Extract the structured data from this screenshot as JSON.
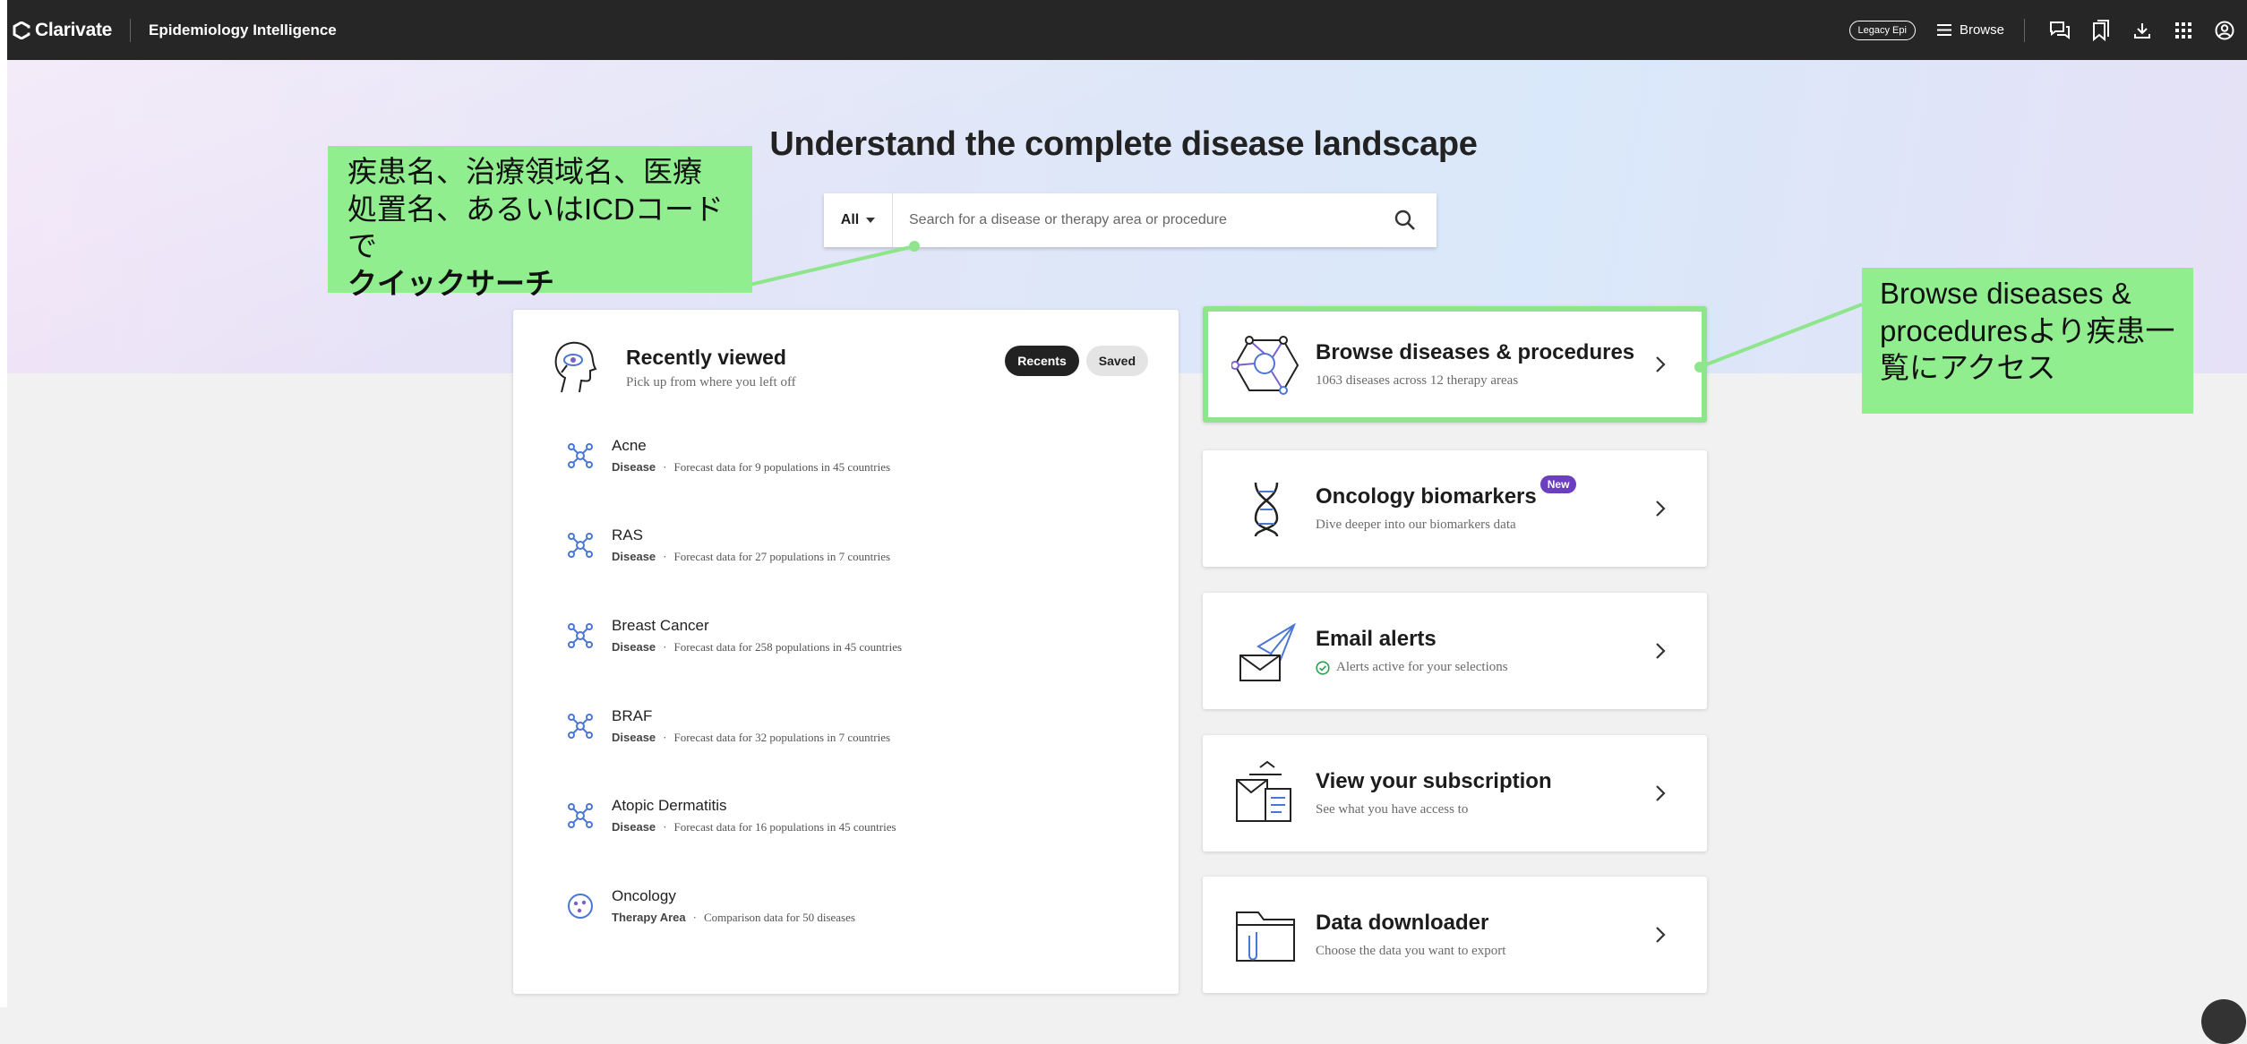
{
  "header": {
    "brand": "Clarivate",
    "product": "Epidemiology Intelligence",
    "legacy_label": "Legacy Epi",
    "browse_label": "Browse",
    "icons": [
      "chat-icon",
      "bookmark-icon",
      "download-icon",
      "apps-grid-icon",
      "user-account-icon"
    ]
  },
  "hero": {
    "headline": "Understand the complete disease landscape",
    "search": {
      "scope": "All",
      "placeholder": "Search for a disease or therapy area or procedure"
    }
  },
  "recent": {
    "title": "Recently viewed",
    "subtitle": "Pick up from where you left off",
    "tabs": {
      "recents": "Recents",
      "saved": "Saved"
    },
    "items": [
      {
        "name": "Acne",
        "kind": "Disease",
        "detail": "Forecast data for 9 populations in 45 countries",
        "icon": "molecule-icon"
      },
      {
        "name": "RAS",
        "kind": "Disease",
        "detail": "Forecast data for 27 populations in 7 countries",
        "icon": "molecule-icon"
      },
      {
        "name": "Breast Cancer",
        "kind": "Disease",
        "detail": "Forecast data for 258 populations in 45 countries",
        "icon": "molecule-icon"
      },
      {
        "name": "BRAF",
        "kind": "Disease",
        "detail": "Forecast data for 32 populations in 7 countries",
        "icon": "molecule-icon"
      },
      {
        "name": "Atopic Dermatitis",
        "kind": "Disease",
        "detail": "Forecast data for 16 populations in 45 countries",
        "icon": "molecule-icon"
      },
      {
        "name": "Oncology",
        "kind": "Therapy Area",
        "detail": "Comparison data for 50 diseases",
        "icon": "cell-icon"
      }
    ]
  },
  "features": {
    "browse": {
      "title": "Browse diseases & procedures",
      "subtitle": "1063 diseases across 12 therapy areas"
    },
    "biomarkers": {
      "title": "Oncology biomarkers",
      "badge": "New",
      "subtitle": "Dive deeper into our biomarkers data"
    },
    "alerts": {
      "title": "Email alerts",
      "subtitle": "Alerts active for your selections"
    },
    "subscription": {
      "title": "View your subscription",
      "subtitle": "See what you have access to"
    },
    "downloader": {
      "title": "Data downloader",
      "subtitle": "Choose the data you want to export"
    }
  },
  "annotations": {
    "note1": {
      "line1": "疾患名、治療領域名、医療",
      "line2": "処置名、あるいはICDコードで",
      "line3": "クイックサーチ"
    },
    "note2": {
      "line1": "Browse diseases &",
      "line2": "proceduresより疾患一",
      "line3": "覧にアクセス"
    }
  },
  "colors": {
    "topbar": "#262626",
    "highlight": "#8ee58b",
    "badge": "#6b3fbf",
    "icon_blue": "#4a77d4"
  }
}
